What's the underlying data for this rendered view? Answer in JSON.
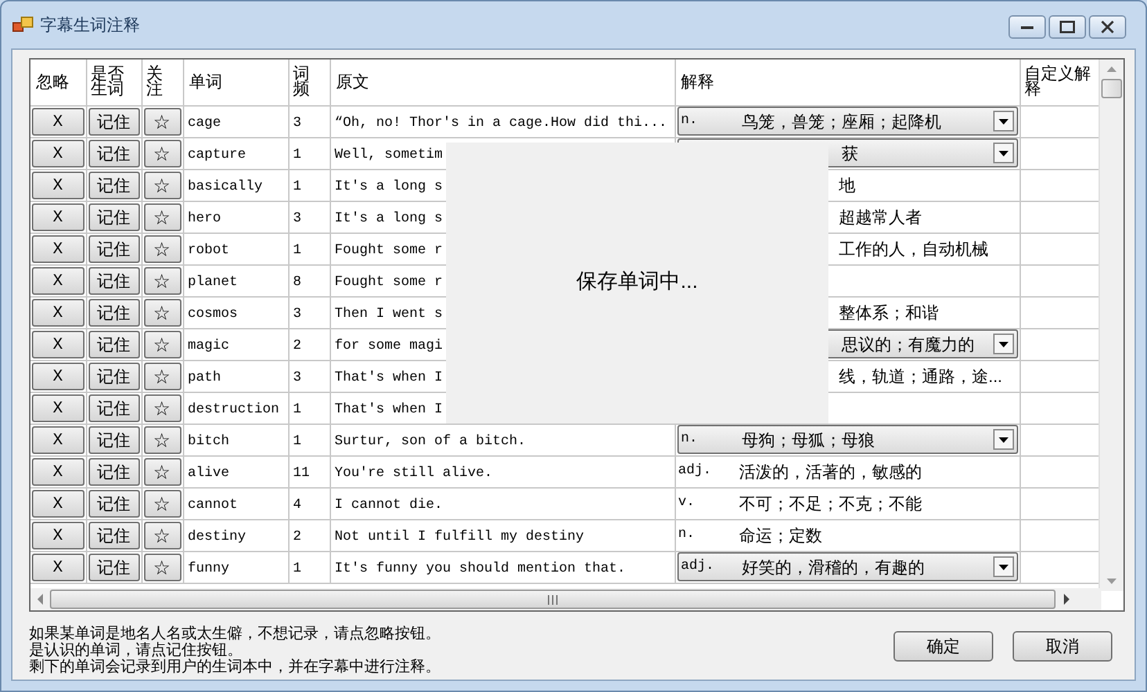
{
  "window": {
    "title": "字幕生词注释"
  },
  "columns": [
    "忽略",
    "是否生词",
    "关注",
    "单词",
    "词频",
    "原文",
    "解释",
    "自定义解释"
  ],
  "rows": [
    {
      "ignore": "X",
      "remember": "记住",
      "star": "☆",
      "word": "cage",
      "frequency": "3",
      "original": "“Oh, no! Thor's in a cage.How did thi...",
      "explanation": {
        "kind": "dropdown",
        "pos": "n.",
        "text": "鸟笼，兽笼；座厢；起降机"
      }
    },
    {
      "ignore": "X",
      "remember": "记住",
      "star": "☆",
      "word": "capture",
      "frequency": "1",
      "original": "Well, sometim",
      "explanation": {
        "kind": "dropdown",
        "text": "获"
      }
    },
    {
      "ignore": "X",
      "remember": "记住",
      "star": "☆",
      "word": "basically",
      "frequency": "1",
      "original": "It's a long s",
      "explanation": {
        "kind": "text",
        "text": "地"
      }
    },
    {
      "ignore": "X",
      "remember": "记住",
      "star": "☆",
      "word": "hero",
      "frequency": "3",
      "original": "It's a long s",
      "explanation": {
        "kind": "text",
        "text": "超越常人者"
      }
    },
    {
      "ignore": "X",
      "remember": "记住",
      "star": "☆",
      "word": "robot",
      "frequency": "1",
      "original": "Fought some r",
      "explanation": {
        "kind": "text",
        "text": "工作的人，自动机械"
      }
    },
    {
      "ignore": "X",
      "remember": "记住",
      "star": "☆",
      "word": "planet",
      "frequency": "8",
      "original": "Fought some r",
      "explanation": {
        "kind": "text"
      }
    },
    {
      "ignore": "X",
      "remember": "记住",
      "star": "☆",
      "word": "cosmos",
      "frequency": "3",
      "original": "Then I went s",
      "explanation": {
        "kind": "text",
        "text": "整体系；和谐"
      }
    },
    {
      "ignore": "X",
      "remember": "记住",
      "star": "☆",
      "word": "magic",
      "frequency": "2",
      "original": "for some magi",
      "explanation": {
        "kind": "dropdown",
        "text": "思议的；有魔力的"
      }
    },
    {
      "ignore": "X",
      "remember": "记住",
      "star": "☆",
      "word": "path",
      "frequency": "3",
      "original": "That's when I",
      "explanation": {
        "kind": "text",
        "text": "线，轨道；通路，途..."
      }
    },
    {
      "ignore": "X",
      "remember": "记住",
      "star": "☆",
      "word": "destruction",
      "frequency": "1",
      "original": "That's when I",
      "explanation": {
        "kind": "text"
      }
    },
    {
      "ignore": "X",
      "remember": "记住",
      "star": "☆",
      "word": "bitch",
      "frequency": "1",
      "original": "Surtur, son of a bitch.",
      "explanation": {
        "kind": "dropdown",
        "pos": "n.",
        "text": "母狗；母狐；母狼"
      }
    },
    {
      "ignore": "X",
      "remember": "记住",
      "star": "☆",
      "word": "alive",
      "frequency": "11",
      "original": "You're still alive.",
      "explanation": {
        "kind": "text",
        "pos": "adj.",
        "text": "活泼的，活著的，敏感的"
      }
    },
    {
      "ignore": "X",
      "remember": "记住",
      "star": "☆",
      "word": "cannot",
      "frequency": "4",
      "original": "I cannot die.",
      "explanation": {
        "kind": "text",
        "pos": "v.",
        "text": "不可；不足；不克；不能"
      }
    },
    {
      "ignore": "X",
      "remember": "记住",
      "star": "☆",
      "word": "destiny",
      "frequency": "2",
      "original": "Not until I fulfill my destiny",
      "explanation": {
        "kind": "text",
        "pos": "n.",
        "text": "命运；定数"
      }
    },
    {
      "ignore": "X",
      "remember": "记住",
      "star": "☆",
      "word": "funny",
      "frequency": "1",
      "original": "It's funny you should mention that.",
      "explanation": {
        "kind": "dropdown",
        "pos": "adj.",
        "text": "好笑的，滑稽的，有趣的"
      }
    }
  ],
  "overlay": {
    "message": "保存单词中..."
  },
  "notes": [
    "如果某单词是地名人名或太生僻，不想记录，请点忽略按钮。",
    "是认识的单词，请点记住按钮。",
    "剩下的单词会记录到用户的生词本中，并在字幕中进行注释。"
  ],
  "buttons": [
    "确定",
    "取消"
  ]
}
